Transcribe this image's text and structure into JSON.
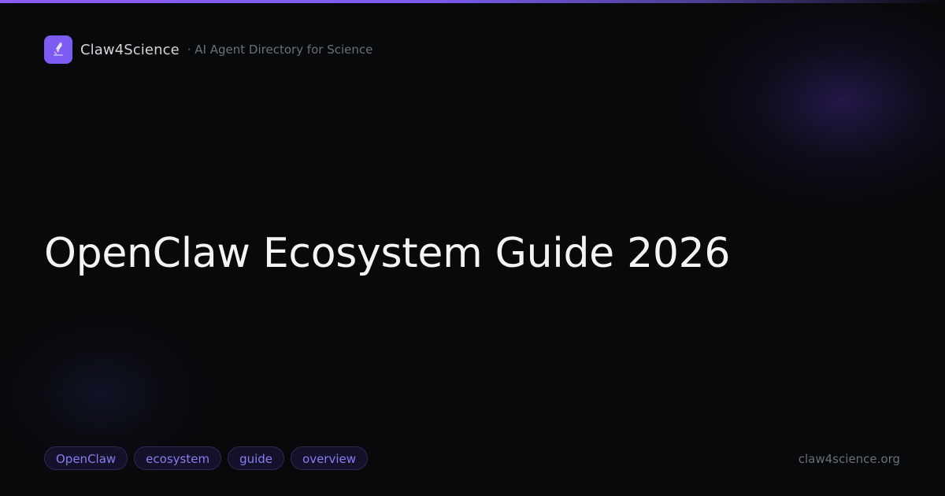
{
  "brand": {
    "name": "Claw4Science",
    "tagline": "· AI Agent Directory for Science",
    "logo_icon": "microscope-icon",
    "accent_color": "#7c5cf2"
  },
  "headline": "OpenClaw Ecosystem Guide 2026",
  "tags": [
    {
      "label": "OpenClaw"
    },
    {
      "label": "ecosystem"
    },
    {
      "label": "guide"
    },
    {
      "label": "overview"
    }
  ],
  "footer": {
    "domain": "claw4science.org"
  },
  "colors": {
    "background": "#08090a",
    "tag_text": "#8b7cf0",
    "headline": "#f4f4f5"
  }
}
